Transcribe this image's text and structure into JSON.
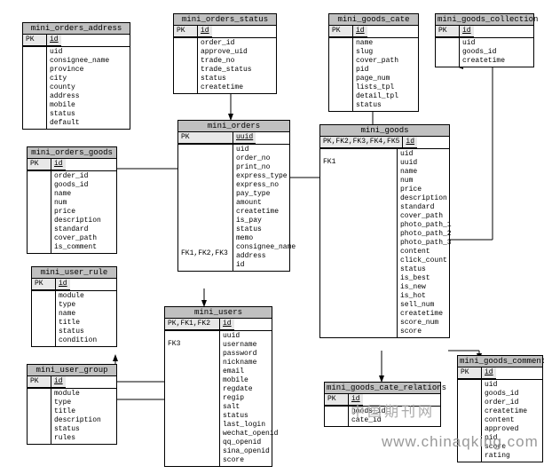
{
  "tables": {
    "orders_address": {
      "title": "mini_orders_address",
      "pk": "PK",
      "idcol": "id",
      "fields": [
        "uid",
        "consignee_name",
        "province",
        "city",
        "county",
        "address",
        "mobile",
        "status",
        "default"
      ]
    },
    "orders_status": {
      "title": "mini_orders_status",
      "pk": "PK",
      "idcol": "id",
      "fields": [
        "order_id",
        "approve_uid",
        "trade_no",
        "trade_status",
        "status",
        "createtime"
      ]
    },
    "goods_cate": {
      "title": "mini_goods_cate",
      "pk": "PK",
      "idcol": "id",
      "fields": [
        "name",
        "slug",
        "cover_path",
        "pid",
        "page_num",
        "lists_tpl",
        "detail_tpl",
        "status"
      ]
    },
    "goods_collection": {
      "title": "mini_goods_collection",
      "pk": "PK",
      "idcol": "id",
      "fields": [
        "uid",
        "goods_id",
        "createtime"
      ]
    },
    "orders": {
      "title": "mini_orders",
      "pk": "PK",
      "idcol": "uuid",
      "fk": "FK1,FK2,FK3",
      "fields": [
        "uid",
        "order_no",
        "print_no",
        "express_type",
        "express_no",
        "pay_type",
        "amount",
        "createtime",
        "is_pay",
        "status",
        "memo",
        "consignee_name",
        "address",
        "id"
      ]
    },
    "goods": {
      "title": "mini_goods",
      "pk": "PK,FK2,FK3,FK4,FK5",
      "idcol": "id",
      "fk": "FK1",
      "fields": [
        "uid",
        "uuid",
        "name",
        "num",
        "price",
        "description",
        "standard",
        "cover_path",
        "photo_path_1",
        "photo_path_2",
        "photo_path_3",
        "content",
        "click_count",
        "status",
        "is_best",
        "is_new",
        "is_hot",
        "sell_num",
        "createtime",
        "score_num",
        "score"
      ]
    },
    "orders_goods": {
      "title": "mini_orders_goods",
      "pk": "PK",
      "idcol": "id",
      "fields": [
        "order_id",
        "goods_id",
        "name",
        "num",
        "price",
        "description",
        "standard",
        "cover_path",
        "is_comment"
      ]
    },
    "user_rule": {
      "title": "mini_user_rule",
      "pk": "PK",
      "idcol": "id",
      "fields": [
        "module",
        "type",
        "name",
        "title",
        "status",
        "condition"
      ]
    },
    "users": {
      "title": "mini_users",
      "pk": "PK,FK1,FK2",
      "idcol": "id",
      "fk": "FK3",
      "fields": [
        "uuid",
        "username",
        "password",
        "nickname",
        "email",
        "mobile",
        "regdate",
        "regip",
        "salt",
        "status",
        "last_login",
        "wechat_openid",
        "qq_openid",
        "sina_openid",
        "score"
      ]
    },
    "user_group": {
      "title": "mini_user_group",
      "pk": "PK",
      "idcol": "id",
      "fields": [
        "module",
        "type",
        "title",
        "description",
        "status",
        "rules"
      ]
    },
    "cate_relations": {
      "title": "mini_goods_cate_relations",
      "pk": "PK",
      "idcol": "id",
      "fields": [
        "goods_id",
        "cate_id"
      ]
    },
    "goods_comment": {
      "title": "mini_goods_comment",
      "pk": "PK",
      "idcol": "id",
      "fields": [
        "uid",
        "goods_id",
        "order_id",
        "createtime",
        "content",
        "approved",
        "pid",
        "score",
        "rating"
      ]
    }
  },
  "watermark": {
    "line1": "中国期刊网",
    "line2": "www.chinaqking.com"
  }
}
